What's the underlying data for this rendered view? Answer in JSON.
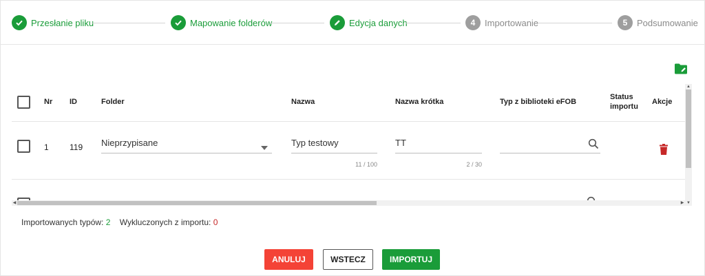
{
  "stepper": {
    "steps": [
      {
        "label": "Przesłanie pliku",
        "state": "done",
        "icon": "check-icon"
      },
      {
        "label": "Mapowanie folderów",
        "state": "done",
        "icon": "check-icon"
      },
      {
        "label": "Edycja danych",
        "state": "active",
        "icon": "pencil-icon"
      },
      {
        "label": "Importowanie",
        "state": "todo",
        "number": "4"
      },
      {
        "label": "Podsumowanie",
        "state": "todo",
        "number": "5"
      }
    ]
  },
  "toolbar": {
    "add_folder_icon": "folder-add-icon"
  },
  "table": {
    "headers": {
      "nr": "Nr",
      "id": "ID",
      "folder": "Folder",
      "name": "Nazwa",
      "short_name": "Nazwa krótka",
      "type": "Typ z biblioteki eFOB",
      "status_line1": "Status",
      "status_line2": "importu",
      "actions": "Akcje"
    },
    "rows": [
      {
        "nr": "1",
        "id": "119",
        "folder": "Nieprzypisane",
        "name": "Typ testowy",
        "name_counter": "11 / 100",
        "short_name": "TT",
        "short_name_counter": "2 / 30",
        "type": ""
      }
    ]
  },
  "summary": {
    "imported_label": "Importowanych typów:",
    "imported_value": "2",
    "excluded_label": "Wykluczonych z importu:",
    "excluded_value": "0"
  },
  "buttons": {
    "cancel": "ANULUJ",
    "back": "WSTECZ",
    "import": "IMPORTUJ"
  },
  "colors": {
    "accent_green": "#1a9c39",
    "danger_red": "#f44336",
    "inactive_grey": "#9e9e9e",
    "delete_icon_red": "#c62828"
  }
}
